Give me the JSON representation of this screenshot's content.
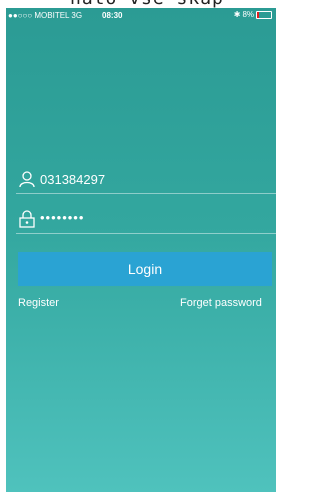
{
  "status_bar": {
    "carrier": "●●○○○ MOBITEL  3G",
    "time": "08:30",
    "battery": "8%"
  },
  "top_strip_text": "nato vse skap",
  "form": {
    "username_value": "031384297",
    "password_value": "••••••••",
    "login_label": "Login",
    "register_label": "Register",
    "forgot_label": "Forget password"
  },
  "colors": {
    "background_top": "#2b9b94",
    "background_bottom": "#4fc2bd",
    "login_button": "#2aa3d3"
  },
  "icons": [
    "user-icon",
    "lock-icon",
    "bluetooth-icon",
    "battery-icon"
  ]
}
